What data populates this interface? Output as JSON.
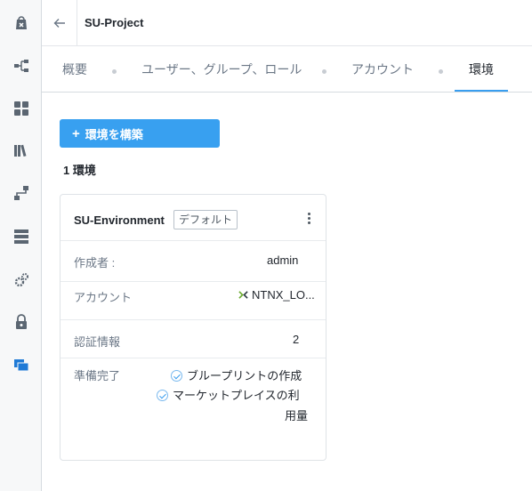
{
  "header": {
    "title": "SU-Project"
  },
  "tabs": [
    {
      "label": "概要"
    },
    {
      "label": "ユーザー、グループ、ロール"
    },
    {
      "label": "アカウント"
    },
    {
      "label": "環境"
    }
  ],
  "active_tab": "環境",
  "main": {
    "build_button": "+ 環境を構築",
    "build_button_label": "環境を構築",
    "env_count": "1 環境"
  },
  "card": {
    "name": "SU-Environment",
    "default_tag": "デフォルト",
    "rows": {
      "creator_label": "作成者 :",
      "creator_value": "admin",
      "account_label": "アカウント",
      "account_value": "NTNX_LO...",
      "credentials_label": "認証情報",
      "credentials_value": "2",
      "ready_label": "準備完了",
      "ready_items": [
        "ブループリントの作成",
        "マーケットプレイスの利",
        "用量"
      ]
    }
  },
  "colors": {
    "accent": "#38a0f0",
    "sidebar_active": "#1f7ad6"
  },
  "sidebar_icons": [
    "bag-x-icon",
    "tree-icon",
    "grid-icon",
    "library-icon",
    "route-icon",
    "server-list-icon",
    "gears-icon",
    "lock-icon",
    "projects-icon"
  ]
}
